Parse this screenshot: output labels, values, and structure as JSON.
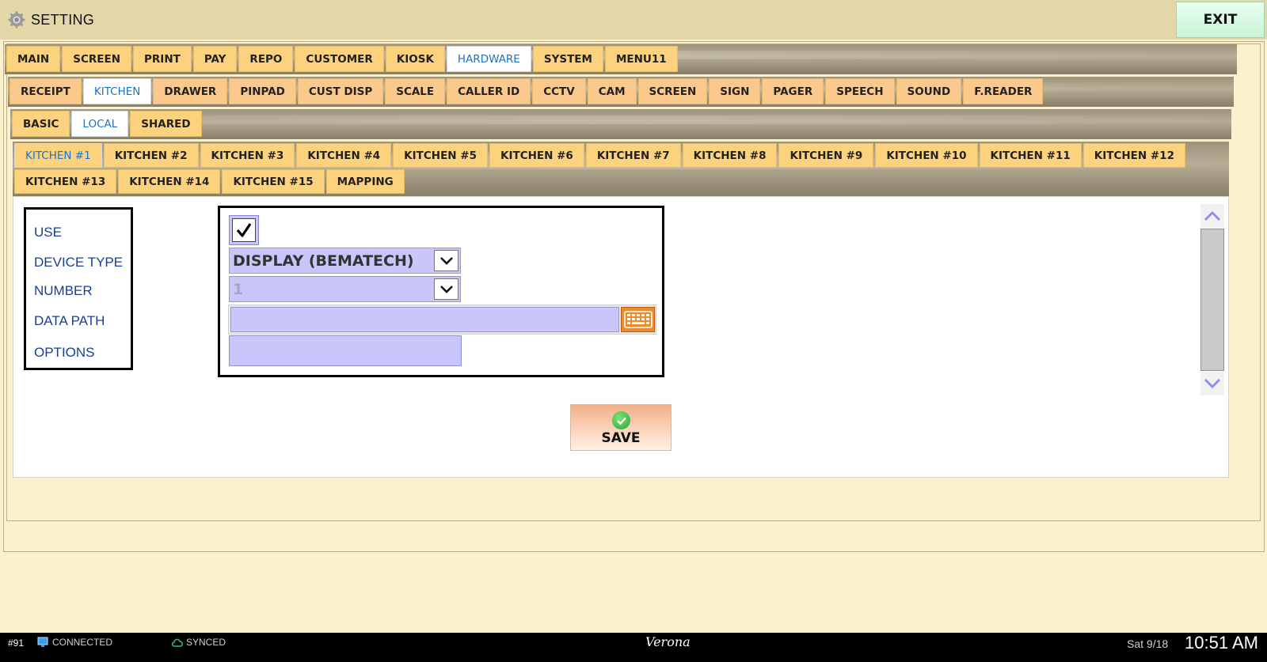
{
  "app": {
    "title": "SETTING",
    "exit_label": "EXIT"
  },
  "tabs_level1": [
    {
      "label": "MAIN",
      "active": false
    },
    {
      "label": "SCREEN",
      "active": false
    },
    {
      "label": "PRINT",
      "active": false
    },
    {
      "label": "PAY",
      "active": false
    },
    {
      "label": "REPO",
      "active": false
    },
    {
      "label": "CUSTOMER",
      "active": false
    },
    {
      "label": "KIOSK",
      "active": false
    },
    {
      "label": "HARDWARE",
      "active": true
    },
    {
      "label": "SYSTEM",
      "active": false
    },
    {
      "label": "MENU11",
      "active": false
    }
  ],
  "tabs_level2": [
    {
      "label": "RECEIPT",
      "active": false
    },
    {
      "label": "KITCHEN",
      "active": true
    },
    {
      "label": "DRAWER",
      "active": false
    },
    {
      "label": "PINPAD",
      "active": false
    },
    {
      "label": "CUST DISP",
      "active": false
    },
    {
      "label": "SCALE",
      "active": false
    },
    {
      "label": "CALLER ID",
      "active": false
    },
    {
      "label": "CCTV",
      "active": false
    },
    {
      "label": "CAM",
      "active": false
    },
    {
      "label": "SCREEN",
      "active": false
    },
    {
      "label": "SIGN",
      "active": false
    },
    {
      "label": "PAGER",
      "active": false
    },
    {
      "label": "SPEECH",
      "active": false
    },
    {
      "label": "SOUND",
      "active": false
    },
    {
      "label": "F.READER",
      "active": false
    }
  ],
  "tabs_level3": [
    {
      "label": "BASIC",
      "active": false
    },
    {
      "label": "LOCAL",
      "active": true
    },
    {
      "label": "SHARED",
      "active": false
    }
  ],
  "tabs_level4": [
    {
      "label": "KITCHEN #1",
      "active": true
    },
    {
      "label": "KITCHEN #2",
      "active": false
    },
    {
      "label": "KITCHEN #3",
      "active": false
    },
    {
      "label": "KITCHEN #4",
      "active": false
    },
    {
      "label": "KITCHEN #5",
      "active": false
    },
    {
      "label": "KITCHEN #6",
      "active": false
    },
    {
      "label": "KITCHEN #7",
      "active": false
    },
    {
      "label": "KITCHEN #8",
      "active": false
    },
    {
      "label": "KITCHEN #9",
      "active": false
    },
    {
      "label": "KITCHEN #10",
      "active": false
    },
    {
      "label": "KITCHEN #11",
      "active": false
    },
    {
      "label": "KITCHEN #12",
      "active": false
    },
    {
      "label": "KITCHEN #13",
      "active": false
    },
    {
      "label": "KITCHEN #14",
      "active": false
    },
    {
      "label": "KITCHEN #15",
      "active": false
    },
    {
      "label": "MAPPING",
      "active": false
    }
  ],
  "form": {
    "labels": {
      "use": "USE",
      "device_type": "DEVICE TYPE",
      "number": "NUMBER",
      "data_path": "DATA PATH",
      "options": "OPTIONS"
    },
    "use_checked": true,
    "device_type_value": "DISPLAY (BEMATECH)",
    "number_value": "1",
    "data_path_value": "",
    "options_value": ""
  },
  "save_label": "SAVE",
  "status": {
    "station": "#91",
    "connection": "CONNECTED",
    "sync": "SYNCED",
    "site": "Verona",
    "date": "Sat 9/18",
    "time": "10:51 AM"
  },
  "colors": {
    "tab_gold": "#fcd27e",
    "tab_peach": "#fbc98c",
    "active_tab_text": "#1b72c7",
    "field_fill": "#c9c6fb",
    "label_text": "#1a3f93",
    "keyboard_button": "#ee8a2a",
    "background": "#fcf1cd"
  }
}
